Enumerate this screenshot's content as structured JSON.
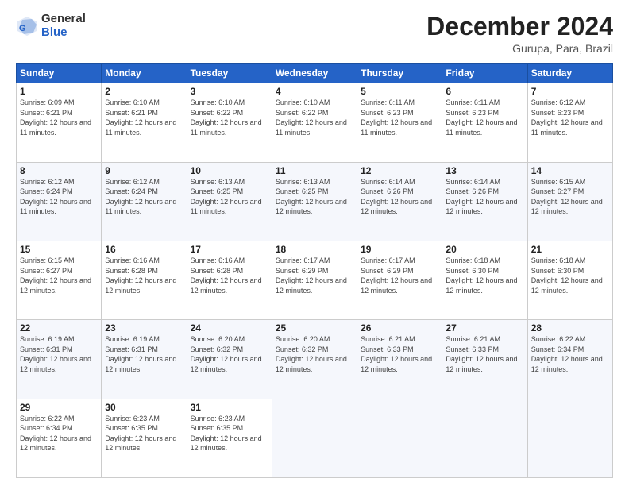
{
  "logo": {
    "general": "General",
    "blue": "Blue"
  },
  "title": "December 2024",
  "location": "Gurupa, Para, Brazil",
  "days_of_week": [
    "Sunday",
    "Monday",
    "Tuesday",
    "Wednesday",
    "Thursday",
    "Friday",
    "Saturday"
  ],
  "weeks": [
    [
      {
        "day": "1",
        "sunrise": "6:09 AM",
        "sunset": "6:21 PM",
        "daylight": "12 hours and 11 minutes."
      },
      {
        "day": "2",
        "sunrise": "6:10 AM",
        "sunset": "6:21 PM",
        "daylight": "12 hours and 11 minutes."
      },
      {
        "day": "3",
        "sunrise": "6:10 AM",
        "sunset": "6:22 PM",
        "daylight": "12 hours and 11 minutes."
      },
      {
        "day": "4",
        "sunrise": "6:10 AM",
        "sunset": "6:22 PM",
        "daylight": "12 hours and 11 minutes."
      },
      {
        "day": "5",
        "sunrise": "6:11 AM",
        "sunset": "6:23 PM",
        "daylight": "12 hours and 11 minutes."
      },
      {
        "day": "6",
        "sunrise": "6:11 AM",
        "sunset": "6:23 PM",
        "daylight": "12 hours and 11 minutes."
      },
      {
        "day": "7",
        "sunrise": "6:12 AM",
        "sunset": "6:23 PM",
        "daylight": "12 hours and 11 minutes."
      }
    ],
    [
      {
        "day": "8",
        "sunrise": "6:12 AM",
        "sunset": "6:24 PM",
        "daylight": "12 hours and 11 minutes."
      },
      {
        "day": "9",
        "sunrise": "6:12 AM",
        "sunset": "6:24 PM",
        "daylight": "12 hours and 11 minutes."
      },
      {
        "day": "10",
        "sunrise": "6:13 AM",
        "sunset": "6:25 PM",
        "daylight": "12 hours and 11 minutes."
      },
      {
        "day": "11",
        "sunrise": "6:13 AM",
        "sunset": "6:25 PM",
        "daylight": "12 hours and 12 minutes."
      },
      {
        "day": "12",
        "sunrise": "6:14 AM",
        "sunset": "6:26 PM",
        "daylight": "12 hours and 12 minutes."
      },
      {
        "day": "13",
        "sunrise": "6:14 AM",
        "sunset": "6:26 PM",
        "daylight": "12 hours and 12 minutes."
      },
      {
        "day": "14",
        "sunrise": "6:15 AM",
        "sunset": "6:27 PM",
        "daylight": "12 hours and 12 minutes."
      }
    ],
    [
      {
        "day": "15",
        "sunrise": "6:15 AM",
        "sunset": "6:27 PM",
        "daylight": "12 hours and 12 minutes."
      },
      {
        "day": "16",
        "sunrise": "6:16 AM",
        "sunset": "6:28 PM",
        "daylight": "12 hours and 12 minutes."
      },
      {
        "day": "17",
        "sunrise": "6:16 AM",
        "sunset": "6:28 PM",
        "daylight": "12 hours and 12 minutes."
      },
      {
        "day": "18",
        "sunrise": "6:17 AM",
        "sunset": "6:29 PM",
        "daylight": "12 hours and 12 minutes."
      },
      {
        "day": "19",
        "sunrise": "6:17 AM",
        "sunset": "6:29 PM",
        "daylight": "12 hours and 12 minutes."
      },
      {
        "day": "20",
        "sunrise": "6:18 AM",
        "sunset": "6:30 PM",
        "daylight": "12 hours and 12 minutes."
      },
      {
        "day": "21",
        "sunrise": "6:18 AM",
        "sunset": "6:30 PM",
        "daylight": "12 hours and 12 minutes."
      }
    ],
    [
      {
        "day": "22",
        "sunrise": "6:19 AM",
        "sunset": "6:31 PM",
        "daylight": "12 hours and 12 minutes."
      },
      {
        "day": "23",
        "sunrise": "6:19 AM",
        "sunset": "6:31 PM",
        "daylight": "12 hours and 12 minutes."
      },
      {
        "day": "24",
        "sunrise": "6:20 AM",
        "sunset": "6:32 PM",
        "daylight": "12 hours and 12 minutes."
      },
      {
        "day": "25",
        "sunrise": "6:20 AM",
        "sunset": "6:32 PM",
        "daylight": "12 hours and 12 minutes."
      },
      {
        "day": "26",
        "sunrise": "6:21 AM",
        "sunset": "6:33 PM",
        "daylight": "12 hours and 12 minutes."
      },
      {
        "day": "27",
        "sunrise": "6:21 AM",
        "sunset": "6:33 PM",
        "daylight": "12 hours and 12 minutes."
      },
      {
        "day": "28",
        "sunrise": "6:22 AM",
        "sunset": "6:34 PM",
        "daylight": "12 hours and 12 minutes."
      }
    ],
    [
      {
        "day": "29",
        "sunrise": "6:22 AM",
        "sunset": "6:34 PM",
        "daylight": "12 hours and 12 minutes."
      },
      {
        "day": "30",
        "sunrise": "6:23 AM",
        "sunset": "6:35 PM",
        "daylight": "12 hours and 12 minutes."
      },
      {
        "day": "31",
        "sunrise": "6:23 AM",
        "sunset": "6:35 PM",
        "daylight": "12 hours and 12 minutes."
      },
      null,
      null,
      null,
      null
    ]
  ]
}
